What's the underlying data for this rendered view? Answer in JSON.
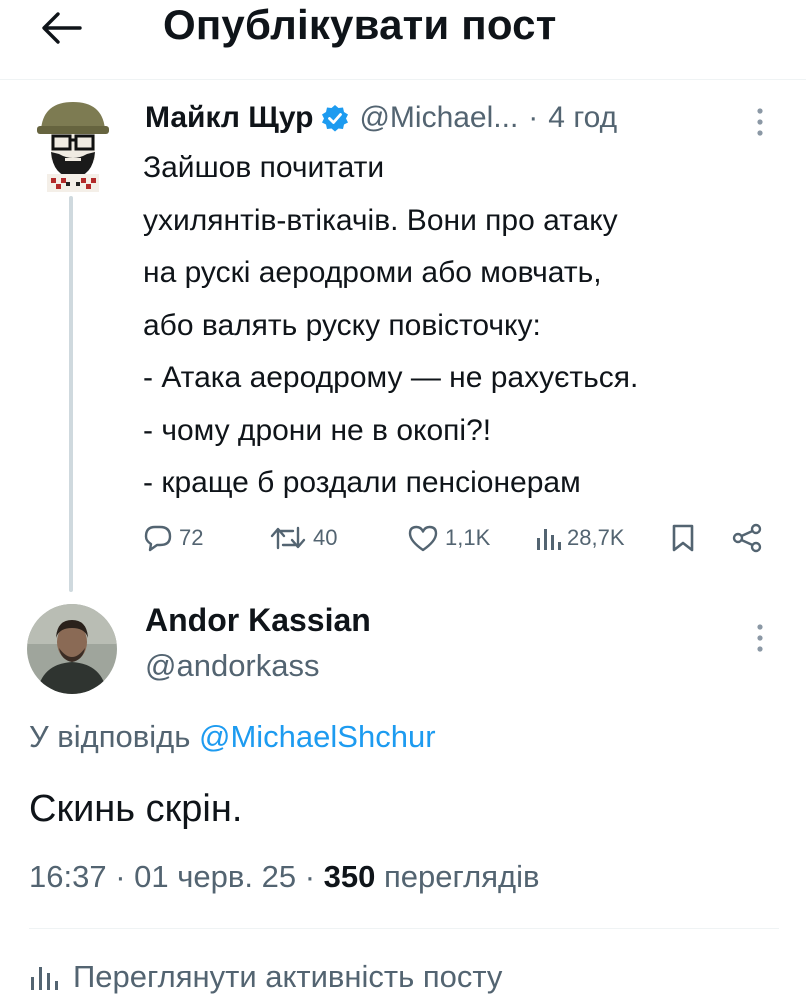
{
  "header": {
    "title": "Опублікувати пост",
    "back_icon": "arrow-left-icon"
  },
  "tweet": {
    "author_name": "Майкл Щур",
    "handle": "@Michael...",
    "separator": "·",
    "time": "4 год",
    "text": "Зайшов почитати\nухилянтів-втікачів. Вони про атаку\nна рускі аеродроми або мовчать,\nабо валять руску повісточку:\n- Атака аеродрому — не рахується.\n- чому дрони не в окопі?!\n- краще б роздали пенсіонерам",
    "stats": {
      "replies": "72",
      "reposts": "40",
      "likes": "1,1K",
      "views": "28,7K"
    }
  },
  "reply": {
    "author_name": "Andor Kassian",
    "handle": "@andorkass",
    "reply_prefix": "У відповідь",
    "reply_mention": "@MichaelShchur",
    "text": "Скинь скрін.",
    "time": "16:37",
    "date": "01 черв. 25",
    "separator": "·",
    "views_count": "350",
    "views_label": "переглядів"
  },
  "footer": {
    "activity_label": "Переглянути активність посту"
  },
  "colors": {
    "text": "#0f1419",
    "secondary": "#536471",
    "accent": "#1d9bf0",
    "divider": "#eff3f4"
  }
}
